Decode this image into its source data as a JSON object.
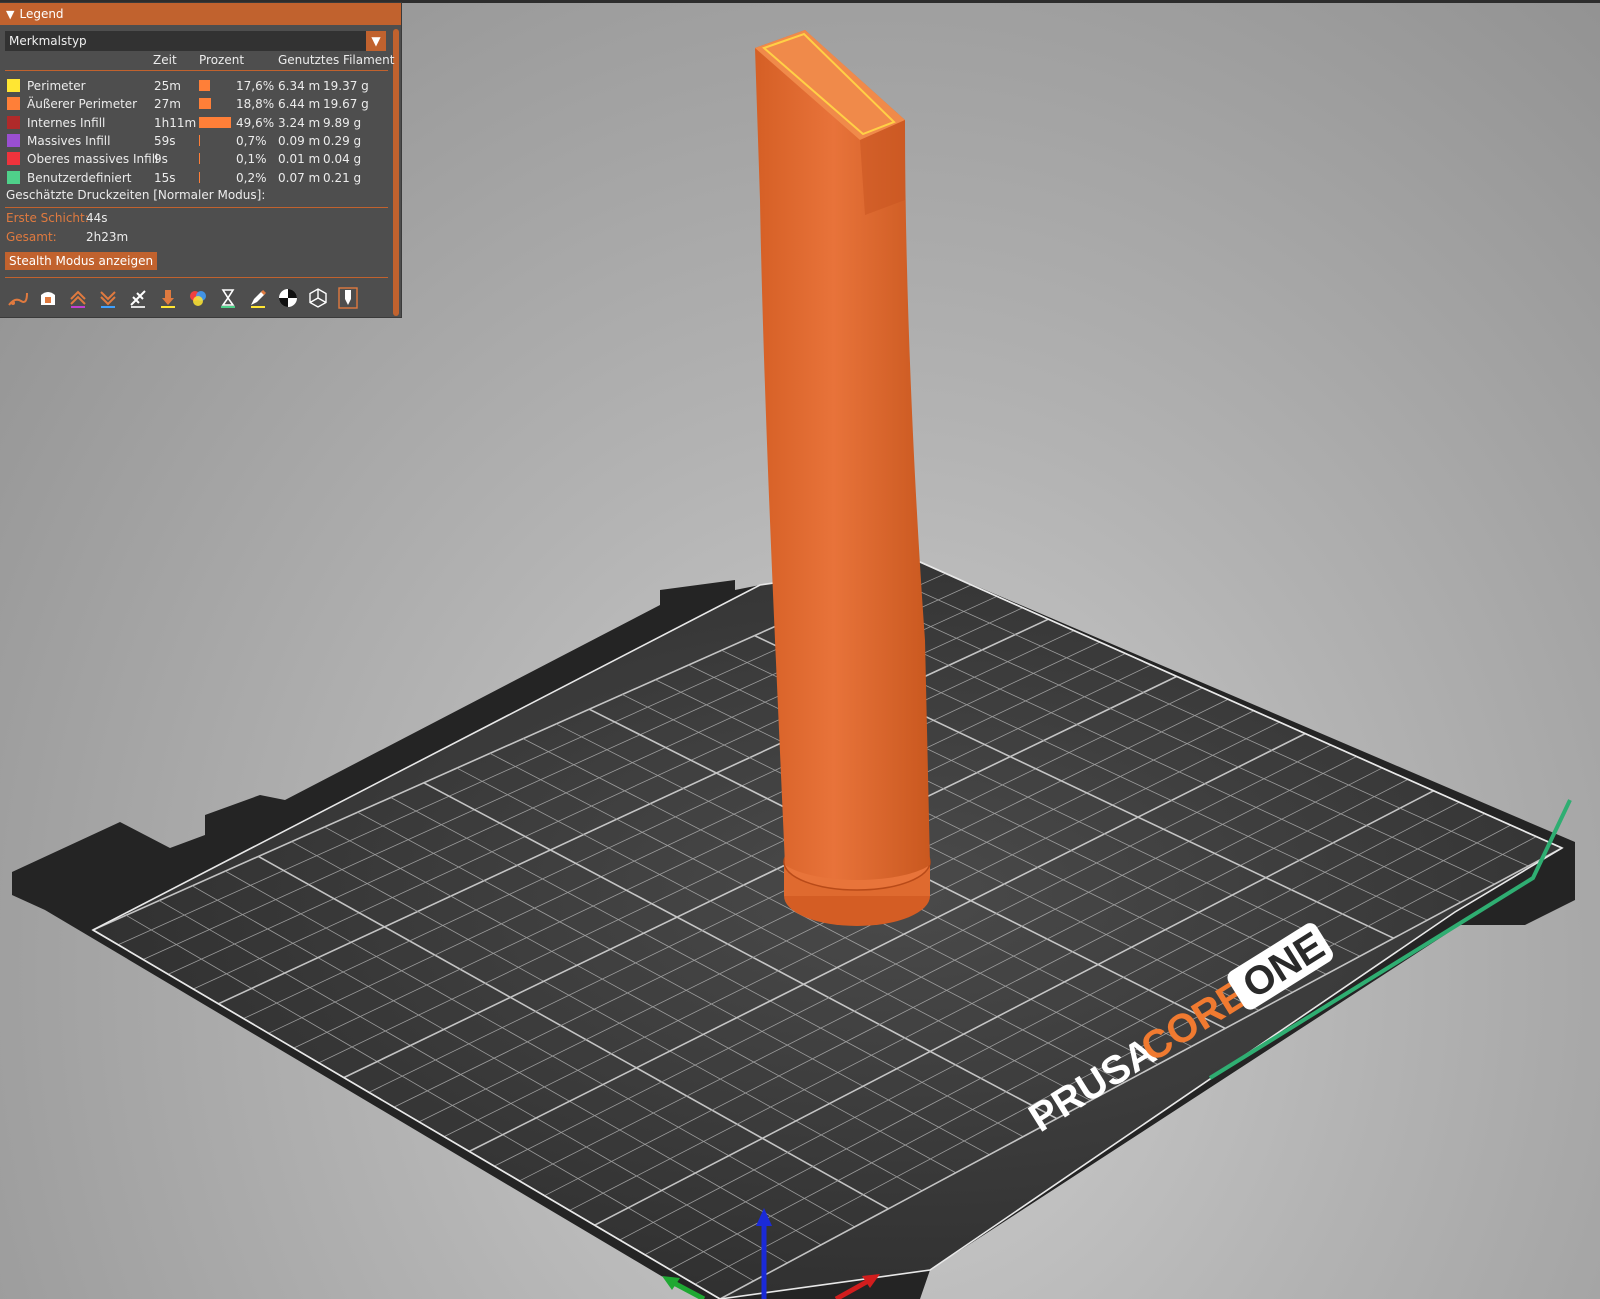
{
  "legend": {
    "title": "Legend",
    "view_type": "Merkmalstyp",
    "columns": {
      "time": "Zeit",
      "percent": "Prozent",
      "filament": "Genutztes Filament"
    },
    "rows": [
      {
        "label": "Perimeter",
        "time": "25m",
        "percent": "17,6%",
        "length": "6.34 m",
        "weight": "19.37 g",
        "color": "#ffe633",
        "fraction": 0.176
      },
      {
        "label": "Äußerer Perimeter",
        "time": "27m",
        "percent": "18,8%",
        "length": "6.44 m",
        "weight": "19.67 g",
        "color": "#ff7f38",
        "fraction": 0.188
      },
      {
        "label": "Internes Infill",
        "time": "1h11m",
        "percent": "49,6%",
        "length": "3.24 m",
        "weight": "9.89 g",
        "color": "#b02a2a",
        "fraction": 0.496
      },
      {
        "label": "Massives Infill",
        "time": "59s",
        "percent": "0,7%",
        "length": "0.09 m",
        "weight": "0.29 g",
        "color": "#9a4fd1",
        "fraction": 0.007
      },
      {
        "label": "Oberes massives Infill",
        "time": "9s",
        "percent": "0,1%",
        "length": "0.01 m",
        "weight": "0.04 g",
        "color": "#f0333c",
        "fraction": 0.001
      },
      {
        "label": "Benutzerdefiniert",
        "time": "15s",
        "percent": "0,2%",
        "length": "0.07 m",
        "weight": "0.21 g",
        "color": "#4fd18a",
        "fraction": 0.002
      }
    ],
    "estimated_title": "Geschätzte Druckzeiten [Normaler Modus]:",
    "first_layer_label": "Erste Schicht:",
    "first_layer_value": "44s",
    "total_label": "Gesamt:",
    "total_value": "2h23m",
    "stealth_button": "Stealth Modus anzeigen",
    "tools": [
      "travel-icon",
      "wipe-icon",
      "retractions-icon",
      "deretractions-icon",
      "seams-icon",
      "tool-changes-icon",
      "color-changes-icon",
      "pause-icon",
      "custom-gcode-icon",
      "center-of-gravity-icon",
      "shells-icon",
      "tool-marker-icon"
    ]
  },
  "scene": {
    "bed_brand": "PRUSA",
    "bed_brand_accent": "CORE",
    "bed_brand_badge": "ONE",
    "model_color": "#e06a2e",
    "accent_color": "#c1622e"
  }
}
